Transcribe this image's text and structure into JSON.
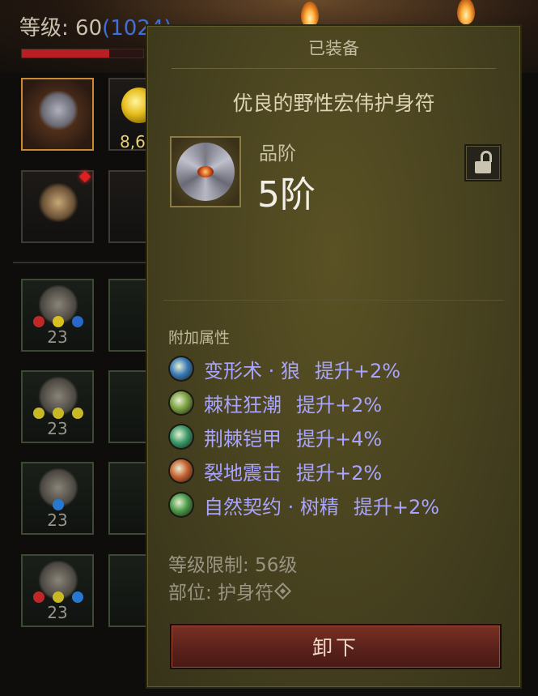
{
  "header": {
    "level_label": "等级: ",
    "level_value": "60",
    "level_extra": "(1024)"
  },
  "hp_fraction": 0.72,
  "currency": {
    "amount": "8,6"
  },
  "equipment_slots": [
    {
      "count": "23",
      "sockets": [
        "#c02828",
        "#d8c020",
        "#2868c8"
      ]
    },
    {
      "count": "23",
      "sockets": [
        "#c8b828",
        "#c8b828",
        "#c8b828"
      ]
    },
    {
      "count": "23",
      "sockets": [
        "#2878d0"
      ]
    },
    {
      "count": "23",
      "sockets": [
        "#c02828",
        "#c8b828",
        "#2878d0"
      ]
    }
  ],
  "tooltip": {
    "status": "已装备",
    "item_name": "优良的野性宏伟护身符",
    "grade_label": "品阶",
    "grade_value": "5阶",
    "attributes_title": "附加属性",
    "attributes": [
      {
        "skill": "变形术 · 狼",
        "bonus": "提升+2%",
        "icon_color": "#3a7ab8"
      },
      {
        "skill": "棘柱狂潮",
        "bonus": "提升+2%",
        "icon_color": "#7aa040"
      },
      {
        "skill": "荆棘铠甲",
        "bonus": "提升+4%",
        "icon_color": "#3a9a6a"
      },
      {
        "skill": "裂地震击",
        "bonus": "提升+2%",
        "icon_color": "#c86030"
      },
      {
        "skill": "自然契约 · 树精",
        "bonus": "提升+2%",
        "icon_color": "#4a9a4a"
      }
    ],
    "level_limit": "等级限制: 56级",
    "slot_text": "部位: 护身符",
    "unequip_label": "卸下"
  }
}
